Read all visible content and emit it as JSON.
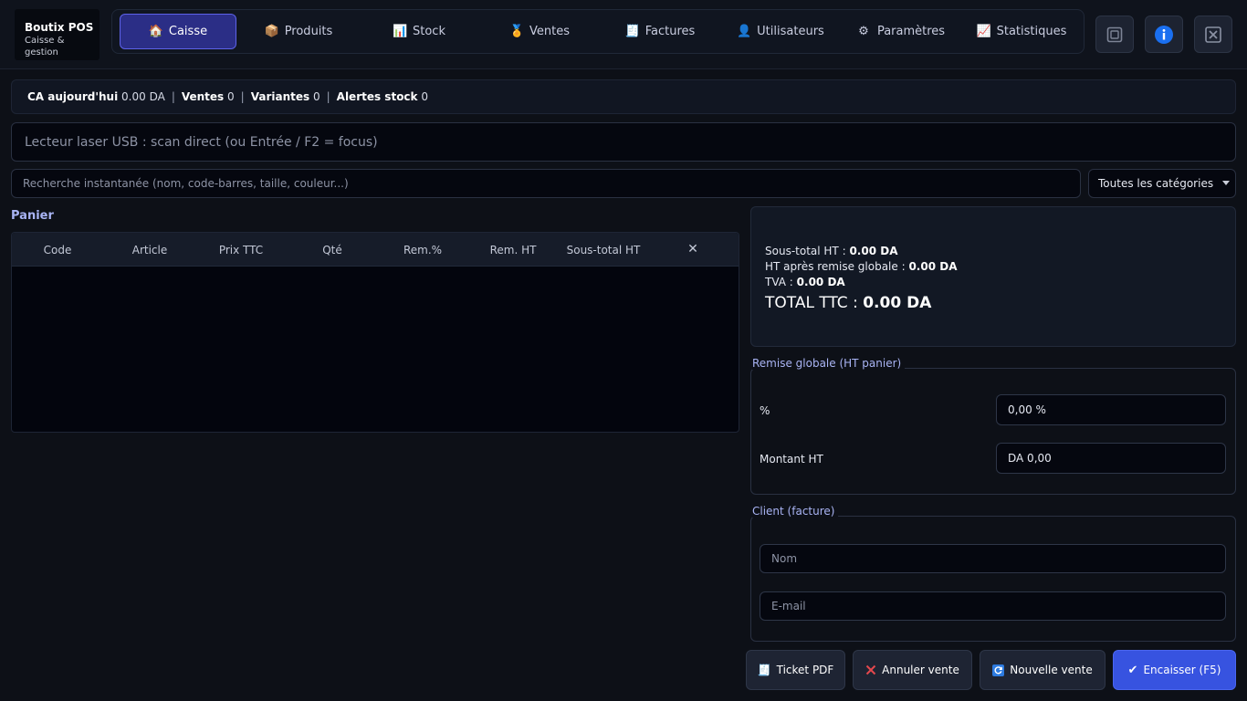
{
  "brand": {
    "title": "Boutix POS",
    "subtitle": "Caisse & gestion"
  },
  "nav": {
    "tabs": [
      {
        "label": "Caisse",
        "icon": "home-icon",
        "active": true
      },
      {
        "label": "Produits",
        "icon": "box-icon"
      },
      {
        "label": "Stock",
        "icon": "bar-chart-icon"
      },
      {
        "label": "Ventes",
        "icon": "medal-icon"
      },
      {
        "label": "Factures",
        "icon": "receipt-icon"
      },
      {
        "label": "Utilisateurs",
        "icon": "user-icon"
      },
      {
        "label": "Paramètres",
        "icon": "gear-icon"
      },
      {
        "label": "Statistiques",
        "icon": "line-chart-icon"
      }
    ]
  },
  "window_controls": [
    "restore-icon",
    "info-icon",
    "close-icon"
  ],
  "stats": {
    "ca_label": "CA aujourd'hui",
    "ca_value": "0.00 DA",
    "ventes_label": "Ventes",
    "ventes_value": "0",
    "variantes_label": "Variantes",
    "variantes_value": "0",
    "alertes_label": "Alertes stock",
    "alertes_value": "0"
  },
  "scan": {
    "placeholder": "Lecteur laser USB : scan direct (ou Entrée / F2 = focus)"
  },
  "search": {
    "placeholder": "Recherche instantanée (nom, code-barres, taille, couleur...)"
  },
  "category": {
    "selected": "Toutes les catégories"
  },
  "cart": {
    "title": "Panier",
    "columns": [
      "Code",
      "Article",
      "Prix TTC",
      "Qté",
      "Rem.%",
      "Rem. HT",
      "Sous-total HT",
      "✕"
    ],
    "rows": []
  },
  "totals": {
    "subtotal_label": "Sous-total HT :",
    "subtotal_value": "0.00 DA",
    "after_discount_label": "HT après remise globale :",
    "after_discount_value": "0.00 DA",
    "tva_label": "TVA :",
    "tva_value": "0.00 DA",
    "ttc_label": "TOTAL TTC :",
    "ttc_value": "0.00 DA"
  },
  "discount": {
    "legend": "Remise globale (HT panier)",
    "percent_label": "%",
    "percent_value": "0,00 %",
    "amount_label": "Montant HT",
    "amount_value": "DA 0,00"
  },
  "client": {
    "legend": "Client (facture)",
    "name_placeholder": "Nom",
    "email_placeholder": "E-mail"
  },
  "actions": {
    "ticket": "Ticket PDF",
    "cancel": "Annuler vente",
    "new": "Nouvelle vente",
    "checkout": "Encaisser (F5)"
  },
  "colors": {
    "accent": "#3753e0",
    "active_tab": "#2b2e86",
    "legend": "#a9b4f4",
    "danger": "#e5484d"
  }
}
